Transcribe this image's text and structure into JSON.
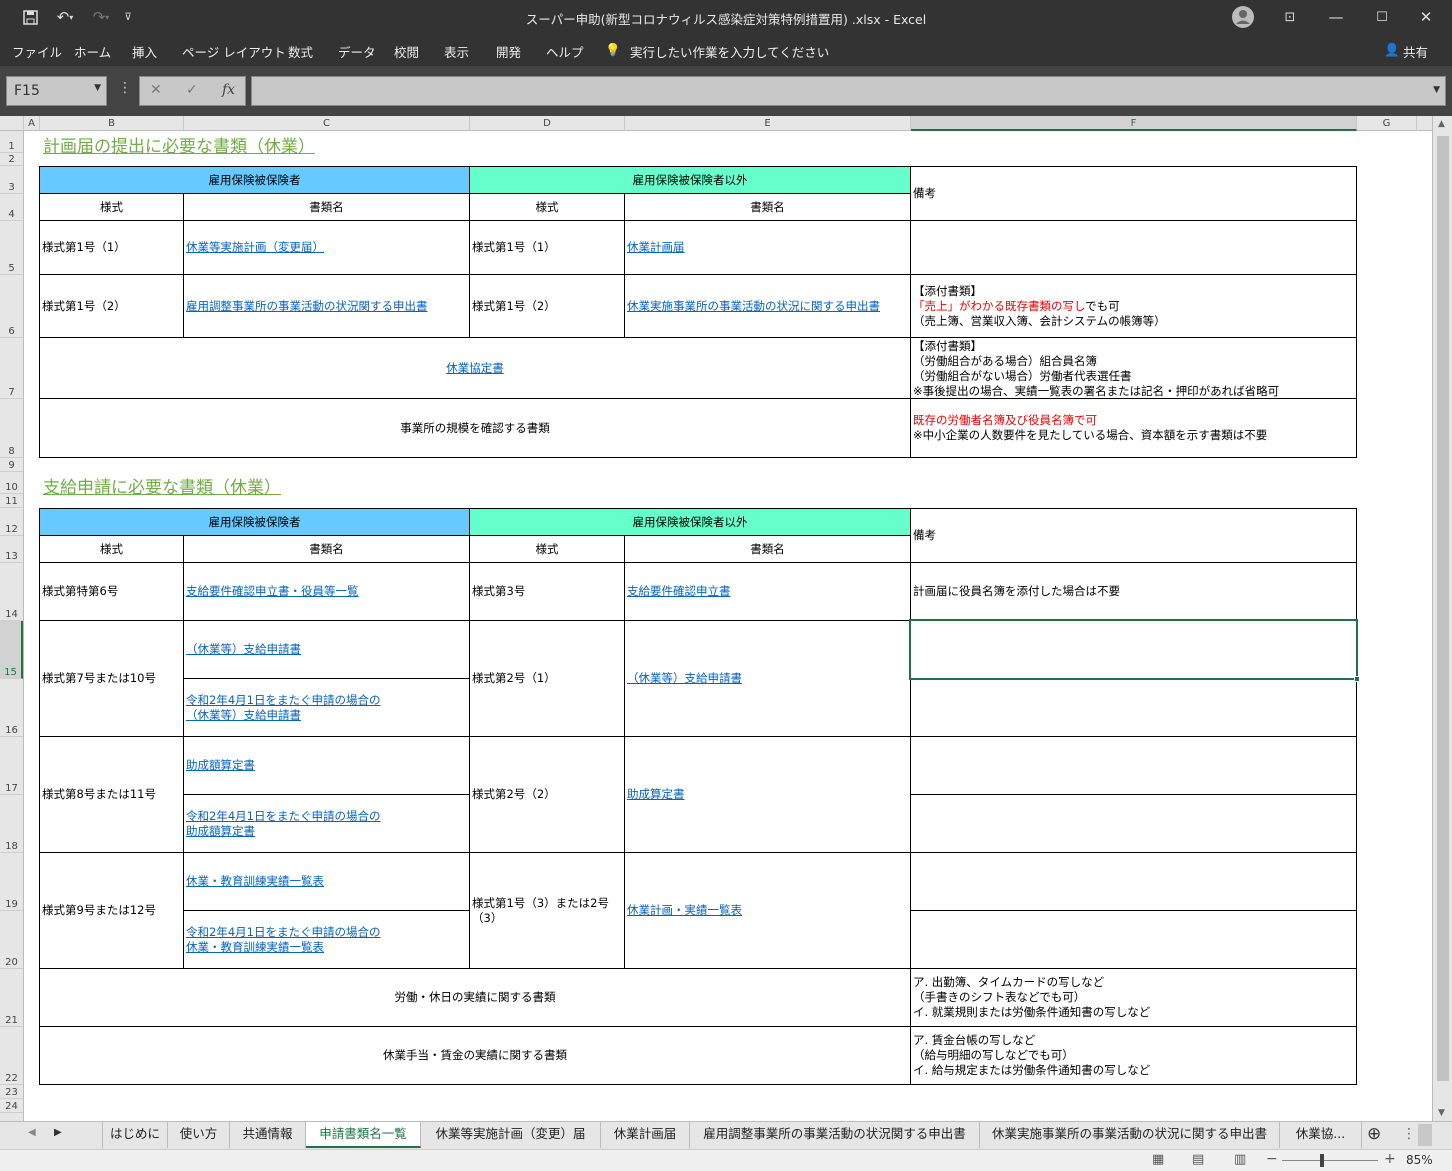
{
  "window": {
    "title": "スーパー申助(新型コロナウィルス感染症対策特例措置用) .xlsx  -  Excel"
  },
  "ribbon": {
    "tabs": [
      "ファイル",
      "ホーム",
      "挿入",
      "ページ レイアウト",
      "数式",
      "データ",
      "校閲",
      "表示",
      "開発",
      "ヘルプ"
    ],
    "tell_me": "実行したい作業を入力してください",
    "share": "共有"
  },
  "formula_bar": {
    "name_box": "F15",
    "formula": ""
  },
  "columns": [
    "A",
    "B",
    "C",
    "D",
    "E",
    "F",
    "G"
  ],
  "rows": [
    "1",
    "2",
    "3",
    "4",
    "5",
    "6",
    "7",
    "8",
    "9",
    "10",
    "11",
    "12",
    "13",
    "14",
    "15",
    "16",
    "17",
    "18",
    "19",
    "20",
    "21",
    "22",
    "23",
    "24"
  ],
  "section1": {
    "title": "計画届の提出に必要な書類（休業）",
    "hdr_insured": "雇用保険被保険者",
    "hdr_other": "雇用保険被保険者以外",
    "hdr_notes": "備考",
    "hdr_form": "様式",
    "hdr_docname": "書類名",
    "r5": {
      "b": "様式第1号（1）",
      "c": "休業等実施計画（変更届）",
      "d": "様式第1号（1）",
      "e": "休業計画届"
    },
    "r6": {
      "b": "様式第1号（2）",
      "c": "雇用調整事業所の事業活動の状況関する申出書",
      "d": "様式第1号（2）",
      "e": "休業実施事業所の事業活動の状況に関する申出書",
      "f1": "【添付書類】",
      "f2_red": "「売上」がわかる既存書類の写し",
      "f2_rest": "でも可",
      "f3": "（売上簿、営業収入簿、会計システムの帳簿等）"
    },
    "r7": {
      "c": "休業協定書",
      "f1": "【添付書類】",
      "f2": "（労働組合がある場合）組合員名簿",
      "f3": "（労働組合がない場合）労働者代表選任書",
      "f4": "※事後提出の場合、実績一覧表の署名または記名・押印があれば省略可"
    },
    "r8": {
      "c": "事業所の規模を確認する書類",
      "f1": "既存の労働者名簿及び役員名簿で可",
      "f2": "※中小企業の人数要件を見たしている場合、資本額を示す書類は不要"
    }
  },
  "section2": {
    "title": "支給申請に必要な書類（休業）",
    "hdr_insured": "雇用保険被保険者",
    "hdr_other": "雇用保険被保険者以外",
    "hdr_notes": "備考",
    "hdr_form": "様式",
    "hdr_docname": "書類名",
    "r14": {
      "b": "様式第特第6号",
      "c": "支給要件確認申立書・役員等一覧",
      "d": "様式第3号",
      "e": "支給要件確認申立書",
      "f": "計画届に役員名簿を添付した場合は不要"
    },
    "r15": {
      "b": "様式第7号または10号",
      "c1": "（休業等）支給申請書 ",
      "c2a": "令和2年4月1日をまたぐ申請の場合の",
      "c2b": "（休業等）支給申請書",
      "d": "様式第2号（1）",
      "e": "（休業等）支給申請書"
    },
    "r17": {
      "b": "様式第8号または11号",
      "c1": "助成額算定書 ",
      "c2a": "令和2年4月1日をまたぐ申請の場合の",
      "c2b": "助成額算定書",
      "d": "様式第2号（2）",
      "e": "助成算定書"
    },
    "r19": {
      "b": "様式第9号または12号",
      "c1": "休業・教育訓練実績一覧表",
      "c2a": "令和2年4月1日をまたぐ申請の場合の",
      "c2b": "休業・教育訓練実績一覧表",
      "d": "様式第1号（3）または2号（3）",
      "e": "休業計画・実績一覧表"
    },
    "r21": {
      "c": "労働・休日の実績に関する書類",
      "f1": "ア. 出勤簿、タイムカードの写しなど",
      "f2": "（手書きのシフト表などでも可）",
      "f3": "イ. 就業規則または労働条件通知書の写しなど"
    },
    "r22": {
      "c": "休業手当・賃金の実績に関する書類",
      "f1": "ア. 賃金台帳の写しなど",
      "f2": "（給与明細の写しなどでも可）",
      "f3": "イ. 給与規定または労働条件通知書の写しなど"
    }
  },
  "sheet_tabs": [
    "はじめに",
    "使い方",
    "共通情報",
    "申請書類名一覧",
    "休業等実施計画（変更）届",
    "休業計画届",
    "雇用調整事業所の事業活動の状況関する申出書",
    "休業実施事業所の事業活動の状況に関する申出書",
    "休業協..."
  ],
  "active_tab": "申請書類名一覧",
  "status": {
    "zoom": "85%"
  }
}
